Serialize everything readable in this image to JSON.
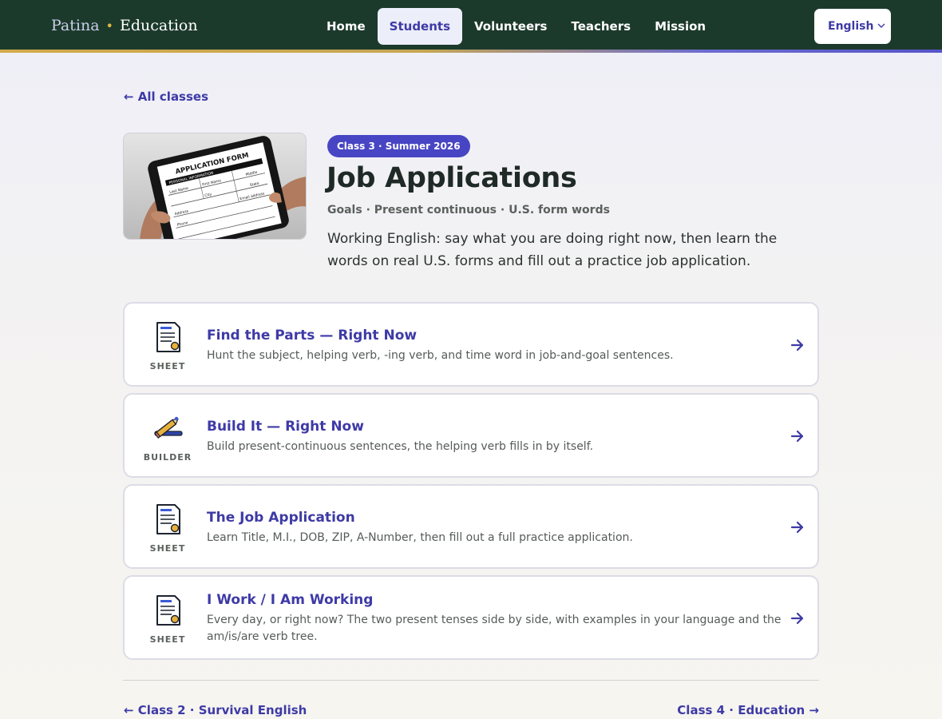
{
  "brand": {
    "first": "Patina",
    "separator": "•",
    "second": "Education"
  },
  "nav": {
    "items": [
      {
        "label": "Home"
      },
      {
        "label": "Students"
      },
      {
        "label": "Volunteers"
      },
      {
        "label": "Teachers"
      },
      {
        "label": "Mission"
      }
    ],
    "active": "Students"
  },
  "language": {
    "selected": "English"
  },
  "back_link": "← All classes",
  "hero": {
    "image": {
      "icon": "tablet-application-form-photo",
      "form_title": "APPLICATION FORM",
      "section": "PERSONAL INFORMATION",
      "fields": [
        "Last Name",
        "First Name",
        "Middle",
        "City",
        "State",
        "Address",
        "Email address",
        "Phone"
      ]
    },
    "badge": "Class 3 · Summer 2026",
    "title": "Job Applications",
    "topics": "Goals · Present continuous · U.S. form words",
    "intro": "Working English: say what you are doing right now, then learn the words on real U.S. forms and fill out a practice job application."
  },
  "activities": [
    {
      "kind": "SHEET",
      "icon": "worksheet-icon",
      "title": "Find the Parts — Right Now",
      "description": "Hunt the subject, helping verb, -ing verb, and time word in job-and-goal sentences."
    },
    {
      "kind": "BUILDER",
      "icon": "builder-icon",
      "title": "Build It — Right Now",
      "description": "Build present-continuous sentences, the helping verb fills in by itself."
    },
    {
      "kind": "SHEET",
      "icon": "worksheet-icon",
      "title": "The Job Application",
      "description": "Learn Title, M.I., DOB, ZIP, A-Number, then fill out a full practice application."
    },
    {
      "kind": "SHEET",
      "icon": "worksheet-icon",
      "title": "I Work / I Am Working",
      "description": "Every day, or right now? The two present tenses side by side, with examples in your language and the am/is/are verb tree."
    }
  ],
  "footer_nav": {
    "prev": "← Class 2 · Survival English",
    "next": "Class 4 · Education →"
  },
  "colors": {
    "header_bg": "#1c3a2c",
    "accent": "#3e3aa6",
    "badge_bg": "#4845c4",
    "gold": "#e1b548"
  }
}
